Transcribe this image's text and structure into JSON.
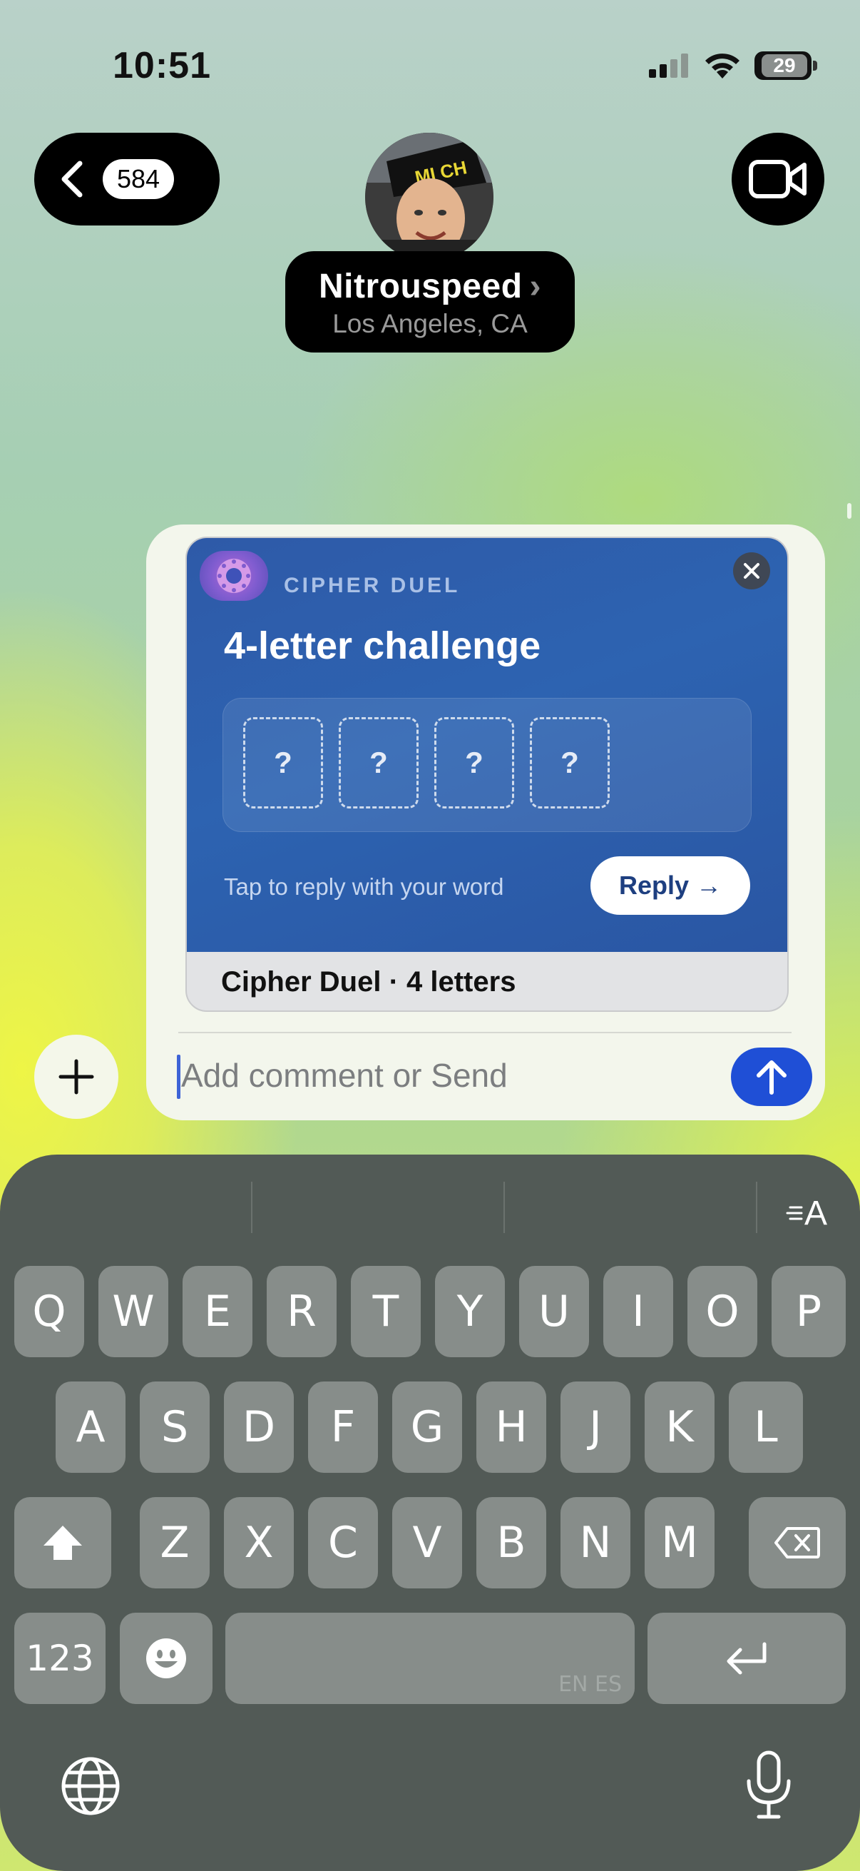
{
  "status": {
    "time": "10:51",
    "battery": "29"
  },
  "header": {
    "back_count": "584",
    "contact_name": "Nitrouspeed",
    "contact_location": "Los Angeles, CA",
    "chevron": "›"
  },
  "card": {
    "app_name": "CIPHER DUEL",
    "title": "4-letter challenge",
    "slots": [
      "?",
      "?",
      "?",
      "?"
    ],
    "hint": "Tap to reply with your word",
    "reply_label": "Reply →",
    "caption": "Cipher Duel · 4 letters"
  },
  "composer": {
    "placeholder": "Add comment or Send"
  },
  "keyboard": {
    "row1": [
      "Q",
      "W",
      "E",
      "R",
      "T",
      "Y",
      "U",
      "I",
      "O",
      "P"
    ],
    "row2": [
      "A",
      "S",
      "D",
      "F",
      "G",
      "H",
      "J",
      "K",
      "L"
    ],
    "row3": [
      "Z",
      "X",
      "C",
      "V",
      "B",
      "N",
      "M"
    ],
    "numbers_label": "123",
    "space_lang": "EN ES",
    "format_label": "A"
  },
  "colors": {
    "send": "#1f4fd6",
    "card_blue": "#2d63b1",
    "keyboard": "#525a56"
  },
  "icons": [
    "back-chevron-icon",
    "video-camera-icon",
    "close-icon",
    "plus-icon",
    "send-arrow-icon",
    "shift-icon",
    "delete-icon",
    "emoji-icon",
    "return-icon",
    "globe-icon",
    "microphone-icon",
    "text-format-icon",
    "signal-icon",
    "wifi-icon",
    "battery-icon"
  ]
}
